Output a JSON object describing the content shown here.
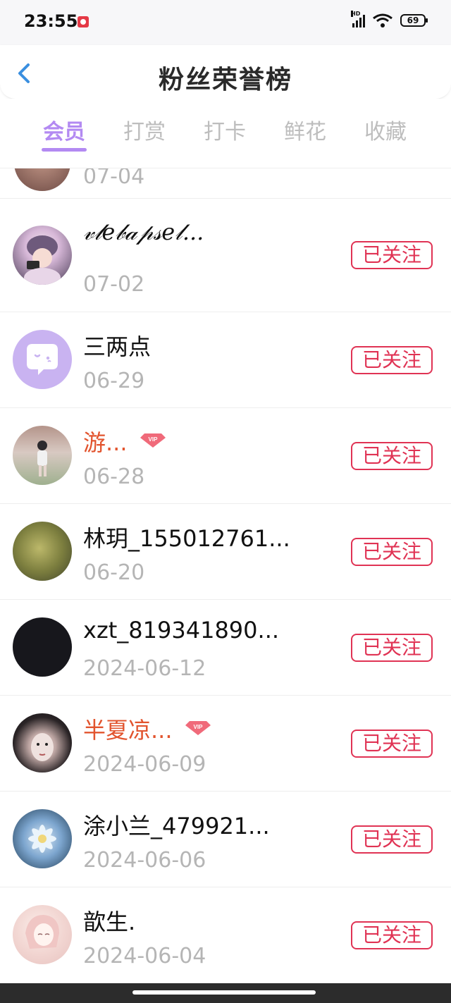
{
  "status_bar": {
    "time": "23:55",
    "network": "HD",
    "battery": "69"
  },
  "header": {
    "title": "粉丝荣誉榜",
    "back_icon": "chevron-left-icon"
  },
  "tabs": [
    {
      "label": "会员",
      "active": true
    },
    {
      "label": "打赏",
      "active": false
    },
    {
      "label": "打卡",
      "active": false
    },
    {
      "label": "鲜花",
      "active": false
    },
    {
      "label": "收藏",
      "active": false
    }
  ],
  "colors": {
    "accent": "#b38af2",
    "follow": "#e03354",
    "vip_name": "#e2542e",
    "date": "#b5b5b5"
  },
  "fans": [
    {
      "name": "",
      "date": "07-04",
      "vip": false,
      "follow_label": ""
    },
    {
      "name": "𝓋𝓁𝑒𝒷𝒶𝓅𝓈𝑒𝓁...",
      "date": "07-02",
      "vip": false,
      "follow_label": "已关注"
    },
    {
      "name": "三两点",
      "date": "06-29",
      "vip": false,
      "follow_label": "已关注"
    },
    {
      "name": "游...",
      "date": "06-28",
      "vip": true,
      "vip_label": "VIP",
      "follow_label": "已关注"
    },
    {
      "name": "林玥_155012761...",
      "date": "06-20",
      "vip": false,
      "follow_label": "已关注"
    },
    {
      "name": "xzt_819341890...",
      "date": "2024-06-12",
      "vip": false,
      "follow_label": "已关注"
    },
    {
      "name": "半夏凉...",
      "date": "2024-06-09",
      "vip": true,
      "vip_label": "VIP",
      "follow_label": "已关注"
    },
    {
      "name": "涂小兰_479921...",
      "date": "2024-06-06",
      "vip": false,
      "follow_label": "已关注"
    },
    {
      "name": "歆生.",
      "date": "2024-06-04",
      "vip": false,
      "follow_label": "已关注"
    }
  ]
}
